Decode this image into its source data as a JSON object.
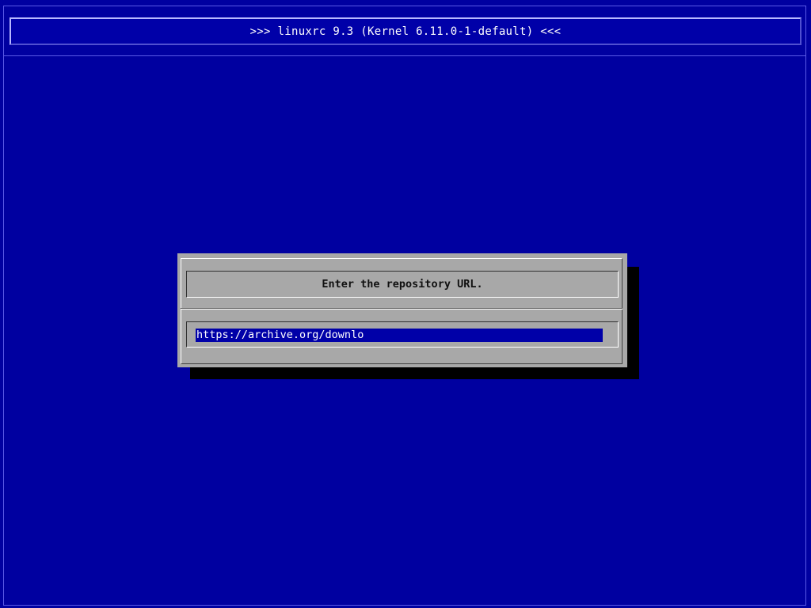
{
  "header": {
    "title": ">>> linuxrc 9.3 (Kernel 6.11.0-1-default) <<<"
  },
  "dialog": {
    "message": "Enter the repository URL.",
    "url_input": {
      "value": "https://archive.org/downlo"
    }
  },
  "colors": {
    "background": "#0000a0",
    "dialog": "#a8a8a8",
    "input_background": "#0000a8",
    "text_light": "#ffffff",
    "text_dark": "#101010"
  }
}
